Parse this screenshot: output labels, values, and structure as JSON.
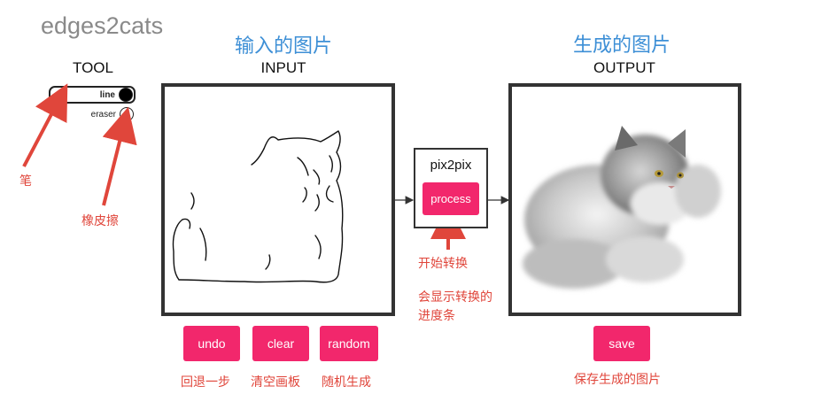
{
  "app": {
    "title": "edges2cats"
  },
  "tool": {
    "heading": "TOOL",
    "line_label": "line",
    "eraser_label": "eraser"
  },
  "input": {
    "annotation": "输入的图片",
    "heading": "INPUT",
    "buttons": {
      "undo": "undo",
      "clear": "clear",
      "random": "random"
    },
    "button_notes": {
      "undo": "回退一步",
      "clear": "清空画板",
      "random": "随机生成"
    }
  },
  "model": {
    "name": "pix2pix",
    "process_label": "process",
    "note_start": "开始转换",
    "note_progress_1": "会显示转换的",
    "note_progress_2": "进度条"
  },
  "output": {
    "annotation": "生成的图片",
    "heading": "OUTPUT",
    "save_label": "save",
    "save_note": "保存生成的图片"
  },
  "notes": {
    "pen": "笔",
    "eraser": "橡皮擦"
  },
  "colors": {
    "accent": "#f2276c",
    "annotation_red": "#e0463b",
    "annotation_blue": "#3d8fd6",
    "frame": "#333333"
  },
  "icons": {
    "arrow_red": "arrow-up-icon",
    "flow_arrow": "arrow-right-icon"
  }
}
